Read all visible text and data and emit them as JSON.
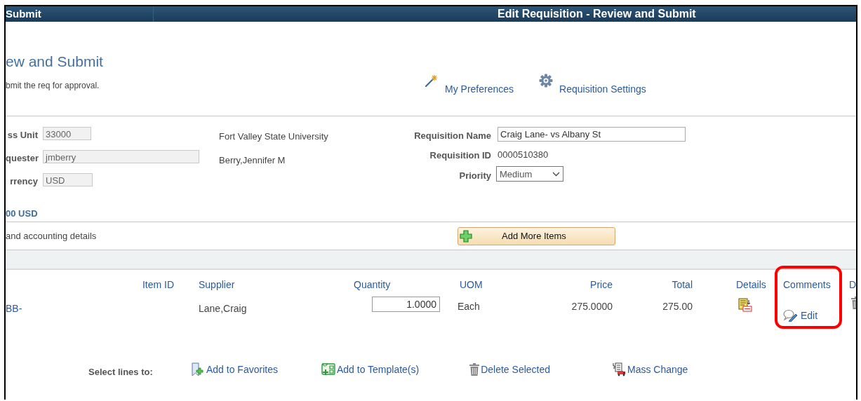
{
  "header": {
    "left_title": "Submit",
    "page_title": "Edit Requisition - Review and Submit"
  },
  "page": {
    "title": "ew and Submit",
    "instructions": "bmit the req for approval."
  },
  "links": [
    {
      "kind": "wand",
      "label": "My Preferences"
    },
    {
      "kind": "gear",
      "label": "Requisition Settings"
    }
  ],
  "left_fields": [
    {
      "label": "ss Unit",
      "value": "33000"
    },
    {
      "label": "quester",
      "value": "jmberry"
    },
    {
      "label": "rrency",
      "value": "USD"
    }
  ],
  "descriptions": [
    "Fort Valley State University",
    "Berry,Jennifer M"
  ],
  "right_fields": [
    {
      "kind": "input",
      "label": "Requisition Name",
      "value": "Craig Lane- vs Albany St"
    },
    {
      "kind": "text",
      "label": "Requisition ID",
      "value": "0000510380"
    },
    {
      "kind": "select",
      "label": "Priority",
      "value": "Medium"
    }
  ],
  "total": "00 USD",
  "details_note": "and accounting details",
  "add_button": "Add More Items",
  "table": {
    "columns": [
      {
        "label": "Item ID",
        "highlighted": false
      },
      {
        "label": "Supplier",
        "highlighted": false
      },
      {
        "label": "Quantity",
        "highlighted": false
      },
      {
        "label": "UOM",
        "highlighted": false
      },
      {
        "label": "Price",
        "highlighted": false
      },
      {
        "label": "Total",
        "highlighted": false
      },
      {
        "label": "Details",
        "highlighted": false
      },
      {
        "label": "Comments",
        "highlighted": true
      },
      {
        "label": "D",
        "highlighted": false
      }
    ],
    "rows": [
      {
        "line_link": "BB-",
        "supplier": "Lane,Craig",
        "quantity": "1.0000",
        "uom": "Each",
        "price": "275.0000",
        "total": "275.00",
        "comments_link": "Edit"
      }
    ]
  },
  "select_lines": {
    "label": "Select lines to:",
    "actions": [
      {
        "kind": "favorites",
        "label": "Add to Favorites"
      },
      {
        "kind": "template",
        "label": "Add to Template(s)"
      },
      {
        "kind": "delete",
        "label": "Delete Selected"
      },
      {
        "kind": "mass",
        "label": "Mass Change"
      }
    ]
  }
}
